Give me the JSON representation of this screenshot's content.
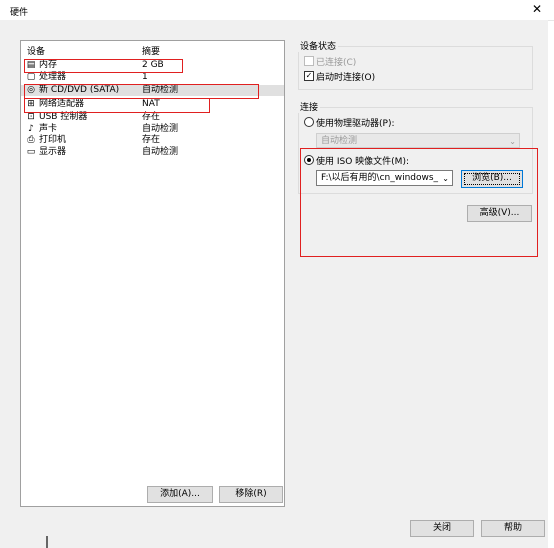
{
  "window": {
    "title": "硬件",
    "close_glyph": "✕"
  },
  "devices": {
    "col_device": "设备",
    "col_summary": "摘要",
    "rows": [
      {
        "name": "内存",
        "summary": "2 GB",
        "icon": "memory-icon",
        "glyph": "▤"
      },
      {
        "name": "处理器",
        "summary": "1",
        "icon": "processor-icon",
        "glyph": "▢"
      },
      {
        "name": "新 CD/DVD (SATA)",
        "summary": "自动检测",
        "icon": "cd-dvd-icon",
        "glyph": "◎"
      },
      {
        "name": "网络适配器",
        "summary": "NAT",
        "icon": "network-adapter-icon",
        "glyph": "⊞"
      },
      {
        "name": "USB 控制器",
        "summary": "存在",
        "icon": "usb-controller-icon",
        "glyph": "⊡"
      },
      {
        "name": "声卡",
        "summary": "自动检测",
        "icon": "sound-card-icon",
        "glyph": "♪"
      },
      {
        "name": "打印机",
        "summary": "存在",
        "icon": "printer-icon",
        "glyph": "⎙"
      },
      {
        "name": "显示器",
        "summary": "自动检测",
        "icon": "display-icon",
        "glyph": "▭"
      }
    ],
    "add_button": "添加(A)...",
    "remove_button": "移除(R)"
  },
  "device_status": {
    "label": "设备状态",
    "connected": "已连接(C)",
    "connect_at_power_on": "启动时连接(O)",
    "check_glyph": "✓"
  },
  "connection": {
    "label": "连接",
    "use_physical": "使用物理驱动器(P):",
    "physical_value": "自动检测",
    "use_iso": "使用 ISO 映像文件(M):",
    "iso_path": "F:\\以后有用的\\cn_windows_",
    "browse_button": "浏览(B)...",
    "advanced_button": "高级(V)..."
  },
  "footer": {
    "close_button": "关闭",
    "help_button": "帮助"
  },
  "colors": {
    "highlight_box": "#e02020",
    "selection": "#e0e0e0",
    "dialog_bg": "#f0f0f0"
  }
}
